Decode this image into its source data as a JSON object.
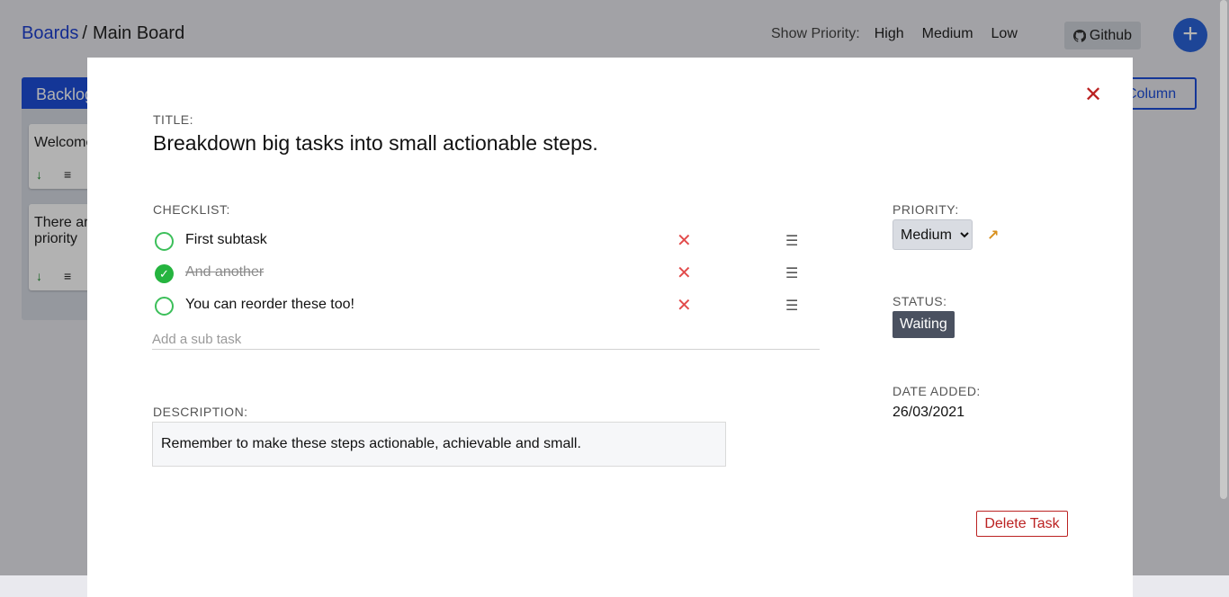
{
  "header": {
    "breadcrumb_boards": "Boards",
    "breadcrumb_sep": "/",
    "breadcrumb_current": "Main Board",
    "priority_filter_label": "Show Priority:",
    "priority_options": [
      "High",
      "Medium",
      "Low"
    ],
    "github_label": "Github",
    "add_icon": "+"
  },
  "board": {
    "column_title": "Backlog",
    "add_column_label": "Column",
    "cards": [
      {
        "text": "Welcome",
        "priority_icon": "↓",
        "menu_icon": "≡"
      },
      {
        "text": "There are priority",
        "priority_icon": "↓",
        "menu_icon": "≡"
      }
    ]
  },
  "modal": {
    "close_icon": "✕",
    "title_label": "TITLE:",
    "title": "Breakdown big tasks into small actionable steps.",
    "checklist_label": "CHECKLIST:",
    "checklist": [
      {
        "text": "First subtask",
        "done": false
      },
      {
        "text": "And another",
        "done": true
      },
      {
        "text": "You can reorder these too!",
        "done": false
      }
    ],
    "delete_item_icon": "✕",
    "drag_icon": "☰",
    "done_icon": "✓",
    "subtask_placeholder": "Add a sub task",
    "description_label": "DESCRIPTION:",
    "description": "Remember to make these steps actionable, achievable and small.",
    "priority_label": "PRIORITY:",
    "priority_value": "Medium",
    "priority_arrow_icon": "↗",
    "status_label": "STATUS:",
    "status_value": "Waiting",
    "date_label": "DATE ADDED:",
    "date_value": "26/03/2021",
    "delete_label": "Delete Task"
  },
  "colors": {
    "accent": "#1e4ed8",
    "danger": "#b22222",
    "success": "#25b43f",
    "priority_medium": "#d8901e",
    "status_badge": "#4a5160"
  }
}
